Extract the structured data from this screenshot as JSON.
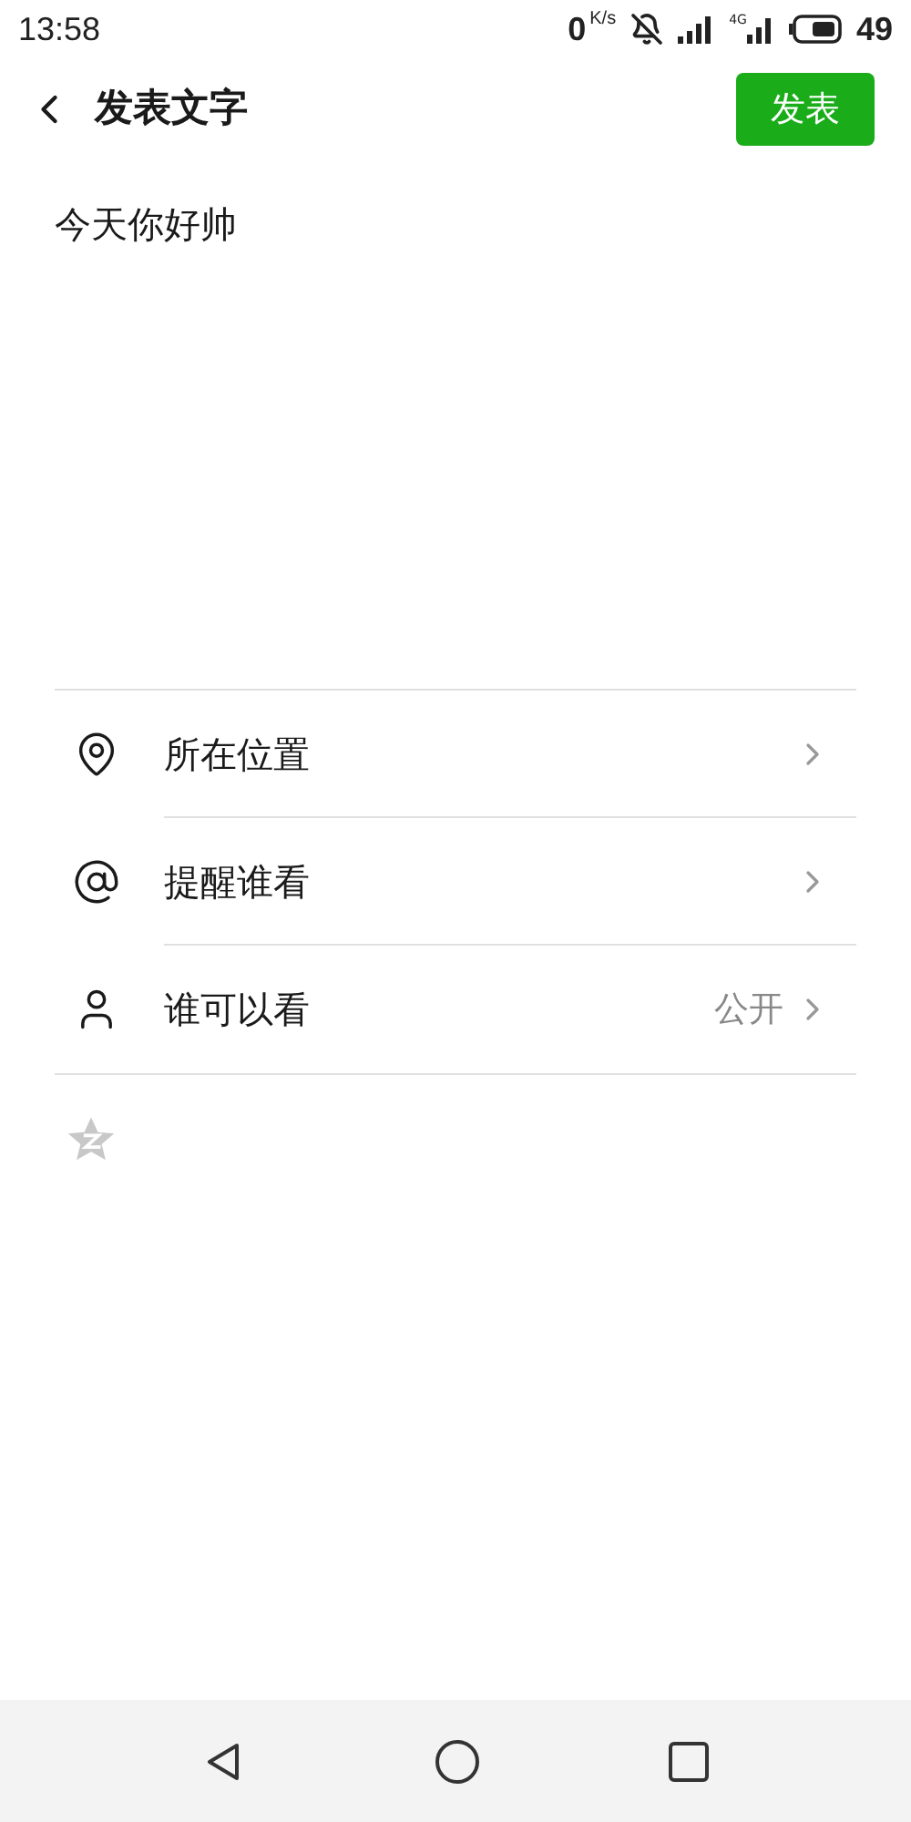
{
  "status_bar": {
    "time": "13:58",
    "speed": "0",
    "speed_unit": "K/s",
    "network": "4G",
    "battery": "49"
  },
  "header": {
    "title": "发表文字",
    "publish_button": "发表"
  },
  "post": {
    "text": "今天你好帅"
  },
  "options": [
    {
      "label": "所在位置"
    },
    {
      "label": "提醒谁看"
    },
    {
      "label": "谁可以看",
      "value": "公开"
    }
  ]
}
